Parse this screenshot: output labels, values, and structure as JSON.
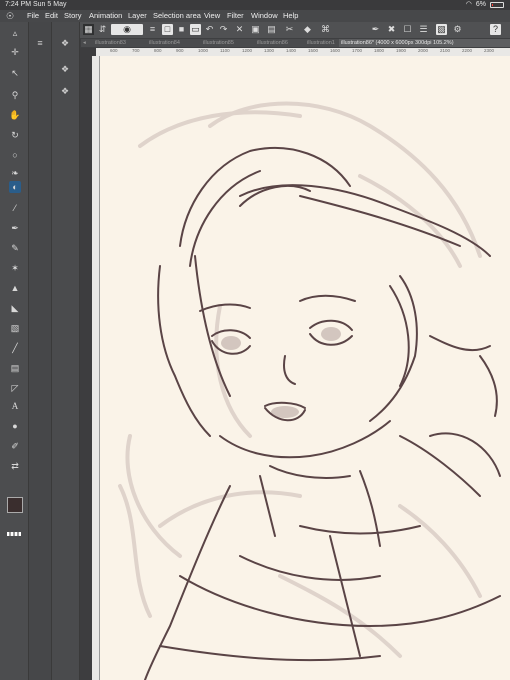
{
  "status": {
    "time": "7:24 PM",
    "date": "Sun 5 May",
    "battery": "6%"
  },
  "menu": [
    "File",
    "Edit",
    "Story",
    "Animation",
    "Layer",
    "Selection area",
    "View",
    "Filter",
    "Window",
    "Help"
  ],
  "tabs": [
    {
      "label": "illustration83"
    },
    {
      "label": "illustration84"
    },
    {
      "label": "illustration85"
    },
    {
      "label": "illustration86"
    },
    {
      "label": "illustration1"
    },
    {
      "label": "illustration86* (4000 x 6000px 300dpi 105.2%)",
      "active": true
    }
  ],
  "ruler_marks": [
    "600",
    "700",
    "800",
    "900",
    "1000",
    "1100",
    "1200",
    "1300",
    "1400",
    "1500",
    "1600",
    "1700",
    "1800",
    "1900",
    "2000",
    "2100",
    "2200",
    "2300"
  ],
  "colors": {
    "accent": "#2a5d8a",
    "canvas": "#faf3e8",
    "ink": "#5a4446"
  }
}
